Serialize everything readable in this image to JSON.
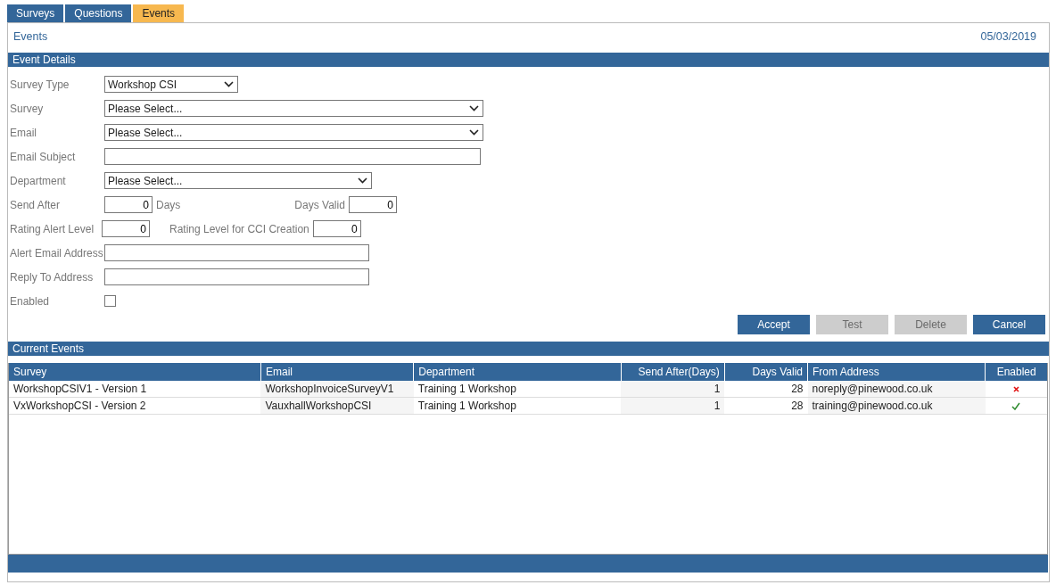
{
  "tabs": [
    {
      "label": "Surveys",
      "selected": false
    },
    {
      "label": "Questions",
      "selected": false
    },
    {
      "label": "Events",
      "selected": true
    }
  ],
  "page": {
    "title": "Events",
    "date": "05/03/2019"
  },
  "event_details": {
    "title": "Event Details",
    "rows": [
      {
        "fields": [
          {
            "label": "Survey Type",
            "kind": "select",
            "value": "Workshop CSI"
          }
        ]
      },
      {
        "fields": [
          {
            "label": "Survey",
            "kind": "select",
            "value": "Please Select..."
          }
        ]
      },
      {
        "fields": [
          {
            "label": "Email",
            "kind": "select",
            "value": "Please Select..."
          }
        ]
      },
      {
        "fields": [
          {
            "label": "Email Subject",
            "kind": "text"
          }
        ]
      },
      {
        "fields": [
          {
            "label": "Department",
            "kind": "select",
            "value": "Please Select..."
          }
        ]
      },
      {
        "fields": [
          {
            "label": "Send After",
            "kind": "number",
            "value": "0",
            "suffix": "Days"
          },
          {
            "label": "Days Valid",
            "kind": "number",
            "value": "0"
          }
        ]
      },
      {
        "fields": [
          {
            "label": "Rating Alert Level",
            "kind": "number",
            "value": "0"
          },
          {
            "label": "Rating Level for CCI Creation",
            "kind": "number",
            "value": "0"
          }
        ]
      },
      {
        "fields": [
          {
            "label": "Alert Email Address",
            "kind": "text"
          }
        ]
      },
      {
        "fields": [
          {
            "label": "Reply To Address",
            "kind": "text"
          }
        ]
      },
      {
        "fields": [
          {
            "label": "Enabled",
            "kind": "checkbox",
            "checked": false
          }
        ]
      }
    ],
    "buttons": [
      {
        "label": "Accept",
        "disabled": false
      },
      {
        "label": "Test",
        "disabled": true
      },
      {
        "label": "Delete",
        "disabled": true
      },
      {
        "label": "Cancel",
        "disabled": false
      }
    ]
  },
  "current_events": {
    "title": "Current Events",
    "table": {
      "columns": [
        "Survey",
        "Email",
        "Department",
        "Send After(Days)",
        "Days Valid",
        "From Address",
        "Enabled"
      ],
      "rows": [
        {
          "survey": "WorkshopCSIV1 - Version 1",
          "email": "WorkshopInvoiceSurveyV1",
          "department": "Training 1 Workshop",
          "send_after": "1",
          "days_valid": "28",
          "from_address": "noreply@pinewood.co.uk",
          "enabled": false
        },
        {
          "survey": "VxWorkshopCSI - Version 2",
          "email": "VauxhallWorkshopCSI",
          "department": "Training 1 Workshop",
          "send_after": "1",
          "days_valid": "28",
          "from_address": "training@pinewood.co.uk",
          "enabled": true
        }
      ]
    }
  }
}
